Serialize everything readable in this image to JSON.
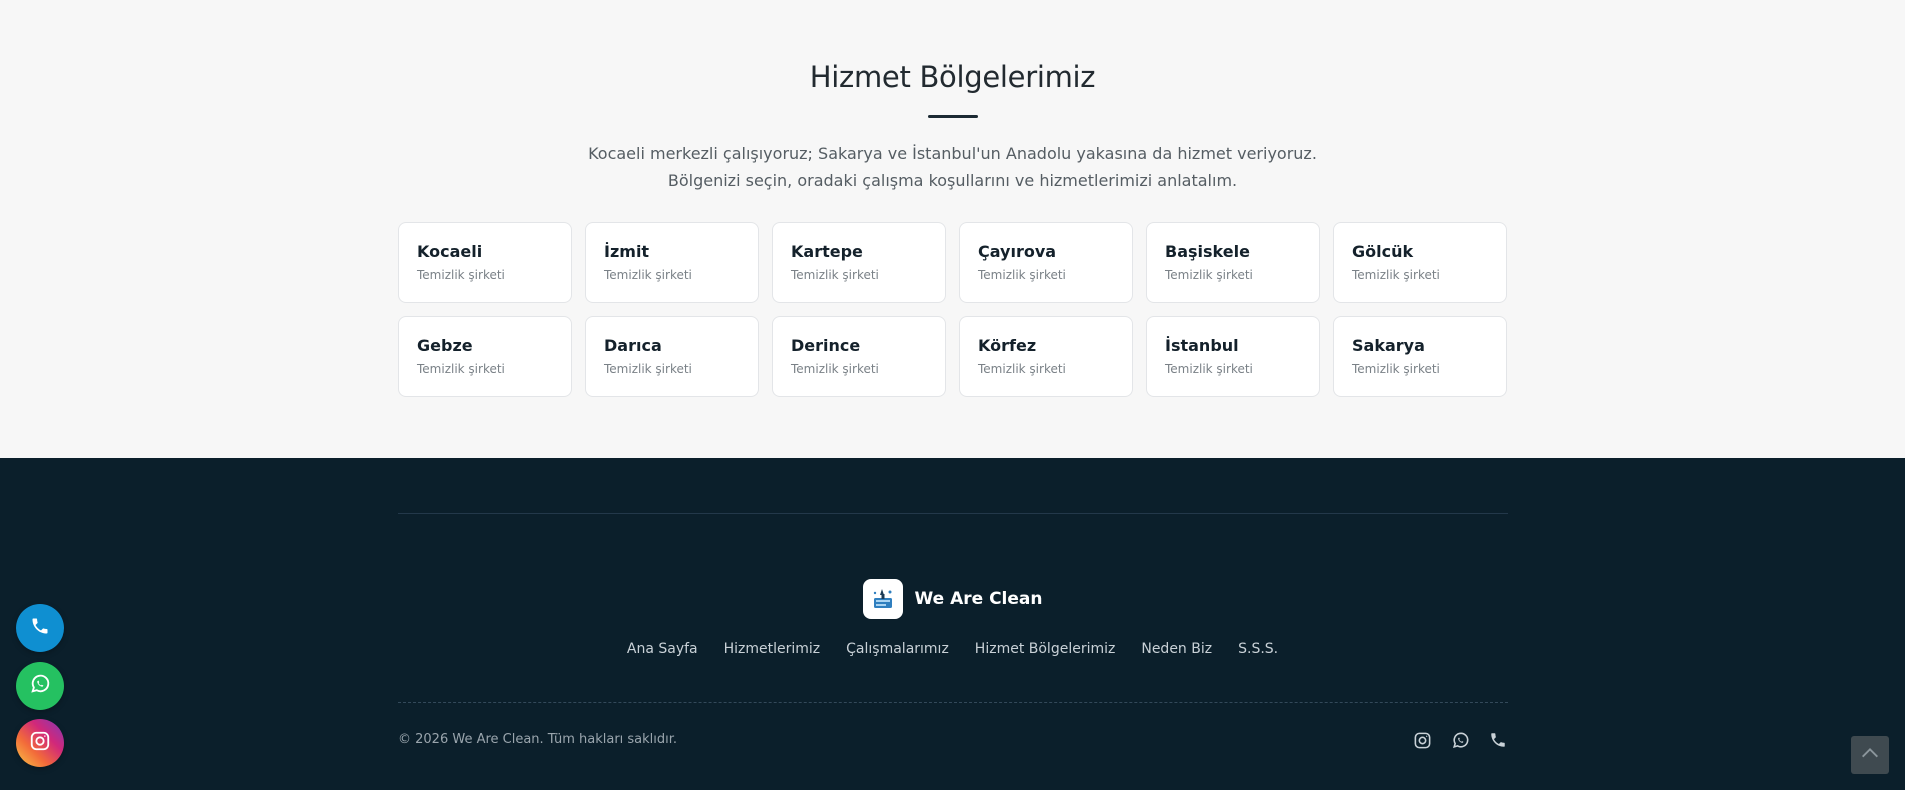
{
  "regions": {
    "title": "Hizmet Bölgelerimiz",
    "description_line1": "Kocaeli merkezli çalışıyoruz; Sakarya ve İstanbul'un Anadolu yakasına da hizmet veriyoruz.",
    "description_line2": "Bölgenizi seçin, oradaki çalışma koşullarını ve hizmetlerimizi anlatalım.",
    "cards": [
      {
        "name": "Kocaeli",
        "sub": "Temizlik şirketi"
      },
      {
        "name": "İzmit",
        "sub": "Temizlik şirketi"
      },
      {
        "name": "Kartepe",
        "sub": "Temizlik şirketi"
      },
      {
        "name": "Çayırova",
        "sub": "Temizlik şirketi"
      },
      {
        "name": "Başiskele",
        "sub": "Temizlik şirketi"
      },
      {
        "name": "Gölcük",
        "sub": "Temizlik şirketi"
      },
      {
        "name": "Gebze",
        "sub": "Temizlik şirketi"
      },
      {
        "name": "Darıca",
        "sub": "Temizlik şirketi"
      },
      {
        "name": "Derince",
        "sub": "Temizlik şirketi"
      },
      {
        "name": "Körfez",
        "sub": "Temizlik şirketi"
      },
      {
        "name": "İstanbul",
        "sub": "Temizlik şirketi"
      },
      {
        "name": "Sakarya",
        "sub": "Temizlik şirketi"
      }
    ]
  },
  "footer": {
    "brand_name": "We Are Clean",
    "logo_icon": "cleaning-logo-icon",
    "nav": [
      "Ana Sayfa",
      "Hizmetlerimiz",
      "Çalışmalarımız",
      "Hizmet Bölgelerimiz",
      "Neden Biz",
      "S.S.S."
    ],
    "copyright": "© 2026 We Are Clean. Tüm hakları saklıdır.",
    "social_icons": [
      "instagram-icon",
      "whatsapp-icon",
      "phone-icon"
    ]
  },
  "floating_buttons": [
    "phone-icon",
    "whatsapp-icon",
    "instagram-icon"
  ],
  "back_to_top_icon": "chevron-up-icon",
  "colors": {
    "section_bg": "#f7f7f7",
    "footer_bg": "#0b1f2b",
    "phone_btn": "#0f8fd1",
    "whatsapp_btn": "#25c161",
    "card_title": "#14212b"
  }
}
